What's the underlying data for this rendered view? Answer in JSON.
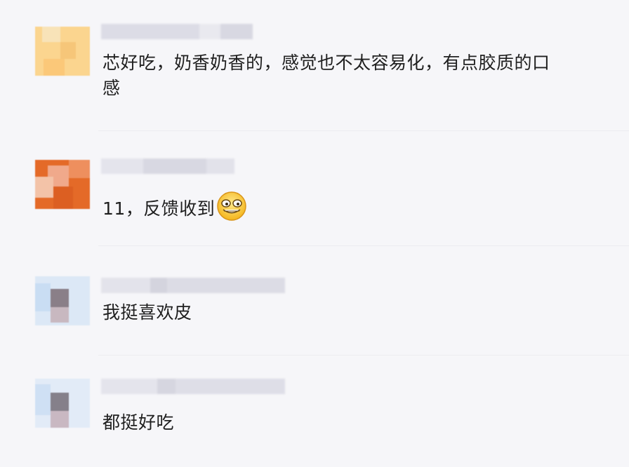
{
  "comments": [
    {
      "text_line1": "芯好吃，奶香奶香的，感觉也不太容易化，有点胶质的口",
      "text_line2": "感"
    },
    {
      "text": "11，反馈收到",
      "emoji": "grinning-face-emoji"
    },
    {
      "text": "我挺喜欢皮"
    },
    {
      "text": "都挺好吃"
    }
  ]
}
